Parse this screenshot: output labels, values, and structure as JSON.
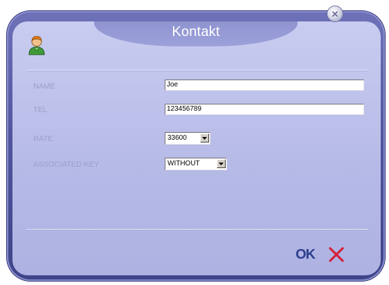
{
  "window": {
    "title": "Kontakt",
    "close_icon": "close-icon",
    "avatar_icon": "contact-avatar-icon"
  },
  "form": {
    "name_label": "NAME",
    "name_value": "Joe",
    "tel_label": "TEL",
    "tel_value": "123456789",
    "rate_label": "RATE",
    "rate_value": "33600",
    "key_label": "ASSOCIATED KEY",
    "key_value": "WITHOUT"
  },
  "actions": {
    "ok_label": "OK",
    "cancel_icon": "cancel-x-icon"
  },
  "colors": {
    "frame": "#52569e",
    "panel": "#c9ccf0",
    "label": "#9a9fcc",
    "ok": "#2e3f8f",
    "cancel": "#d4203a"
  }
}
